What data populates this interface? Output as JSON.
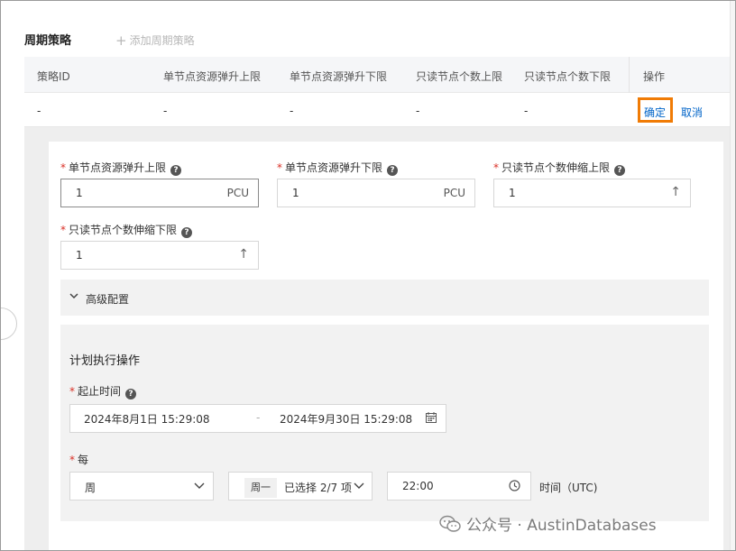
{
  "section": {
    "title": "周期策略",
    "add_label": "添加周期策略"
  },
  "table": {
    "headers": [
      "策略ID",
      "单节点资源弹升上限",
      "单节点资源弹升下限",
      "只读节点个数上限",
      "只读节点个数下限",
      "操作"
    ],
    "row": [
      "-",
      "-",
      "-",
      "-",
      "-"
    ],
    "actions": {
      "confirm": "确定",
      "cancel": "取消"
    }
  },
  "form": {
    "upper_limit": {
      "label": "单节点资源弹升上限",
      "value": "1",
      "unit": "PCU"
    },
    "lower_limit": {
      "label": "单节点资源弹升下限",
      "value": "1",
      "unit": "PCU"
    },
    "ro_upper": {
      "label": "只读节点个数伸缩上限",
      "value": "1"
    },
    "ro_lower": {
      "label": "只读节点个数伸缩下限",
      "value": "1"
    },
    "advanced_label": "高级配置"
  },
  "plan": {
    "title": "计划执行操作",
    "time_range_label": "起止时间",
    "start": "2024年8月1日 15:29:08",
    "separator": "-",
    "end": "2024年9月30日 15:29:08",
    "every_label": "每",
    "period": "周",
    "day_tag": "周一",
    "selected_text": "已选择 2/7 项",
    "time": "22:00",
    "time_unit_label": "时间（UTC)"
  },
  "watermark": "公众号 · AustinDatabases",
  "colors": {
    "link": "#0064c8",
    "highlight": "#f07b05",
    "required": "#d93026"
  }
}
